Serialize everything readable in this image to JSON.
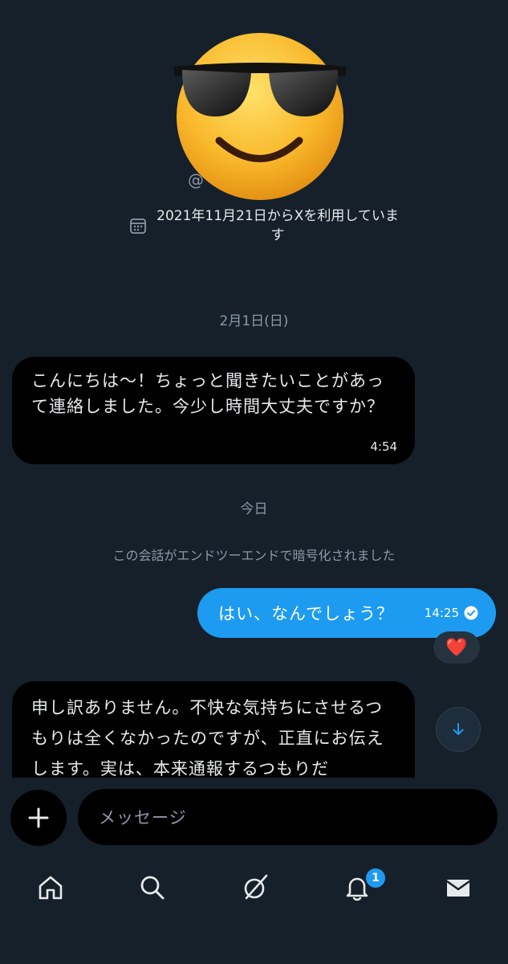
{
  "profile": {
    "handle": "@",
    "joined": "2021年11月21日からXを利用しています"
  },
  "conversation": {
    "date_old": "2月1日(日)",
    "msg1": {
      "text": "こんにちは〜！ちょっと聞きたいことがあって連絡しました。今少し時間大丈夫ですか？",
      "time": "4:54"
    },
    "date_today": "今日",
    "encryption_notice": "この会話がエンドツーエンドで暗号化されました",
    "msg2": {
      "text": "はい、なんでしょう？",
      "time": "14:25",
      "reaction": "❤️"
    },
    "msg3": {
      "text": "申し訳ありません。不快な気持ちにさせるつもりは全くなかったのですが、正直にお伝えします。実は、本来通報するつもりだ"
    }
  },
  "composer": {
    "placeholder": "メッセージ"
  },
  "nav": {
    "notifications_badge": "1"
  },
  "colors": {
    "background": "#15202b",
    "accent": "#1d9bf0",
    "incoming_bubble": "#000000"
  }
}
